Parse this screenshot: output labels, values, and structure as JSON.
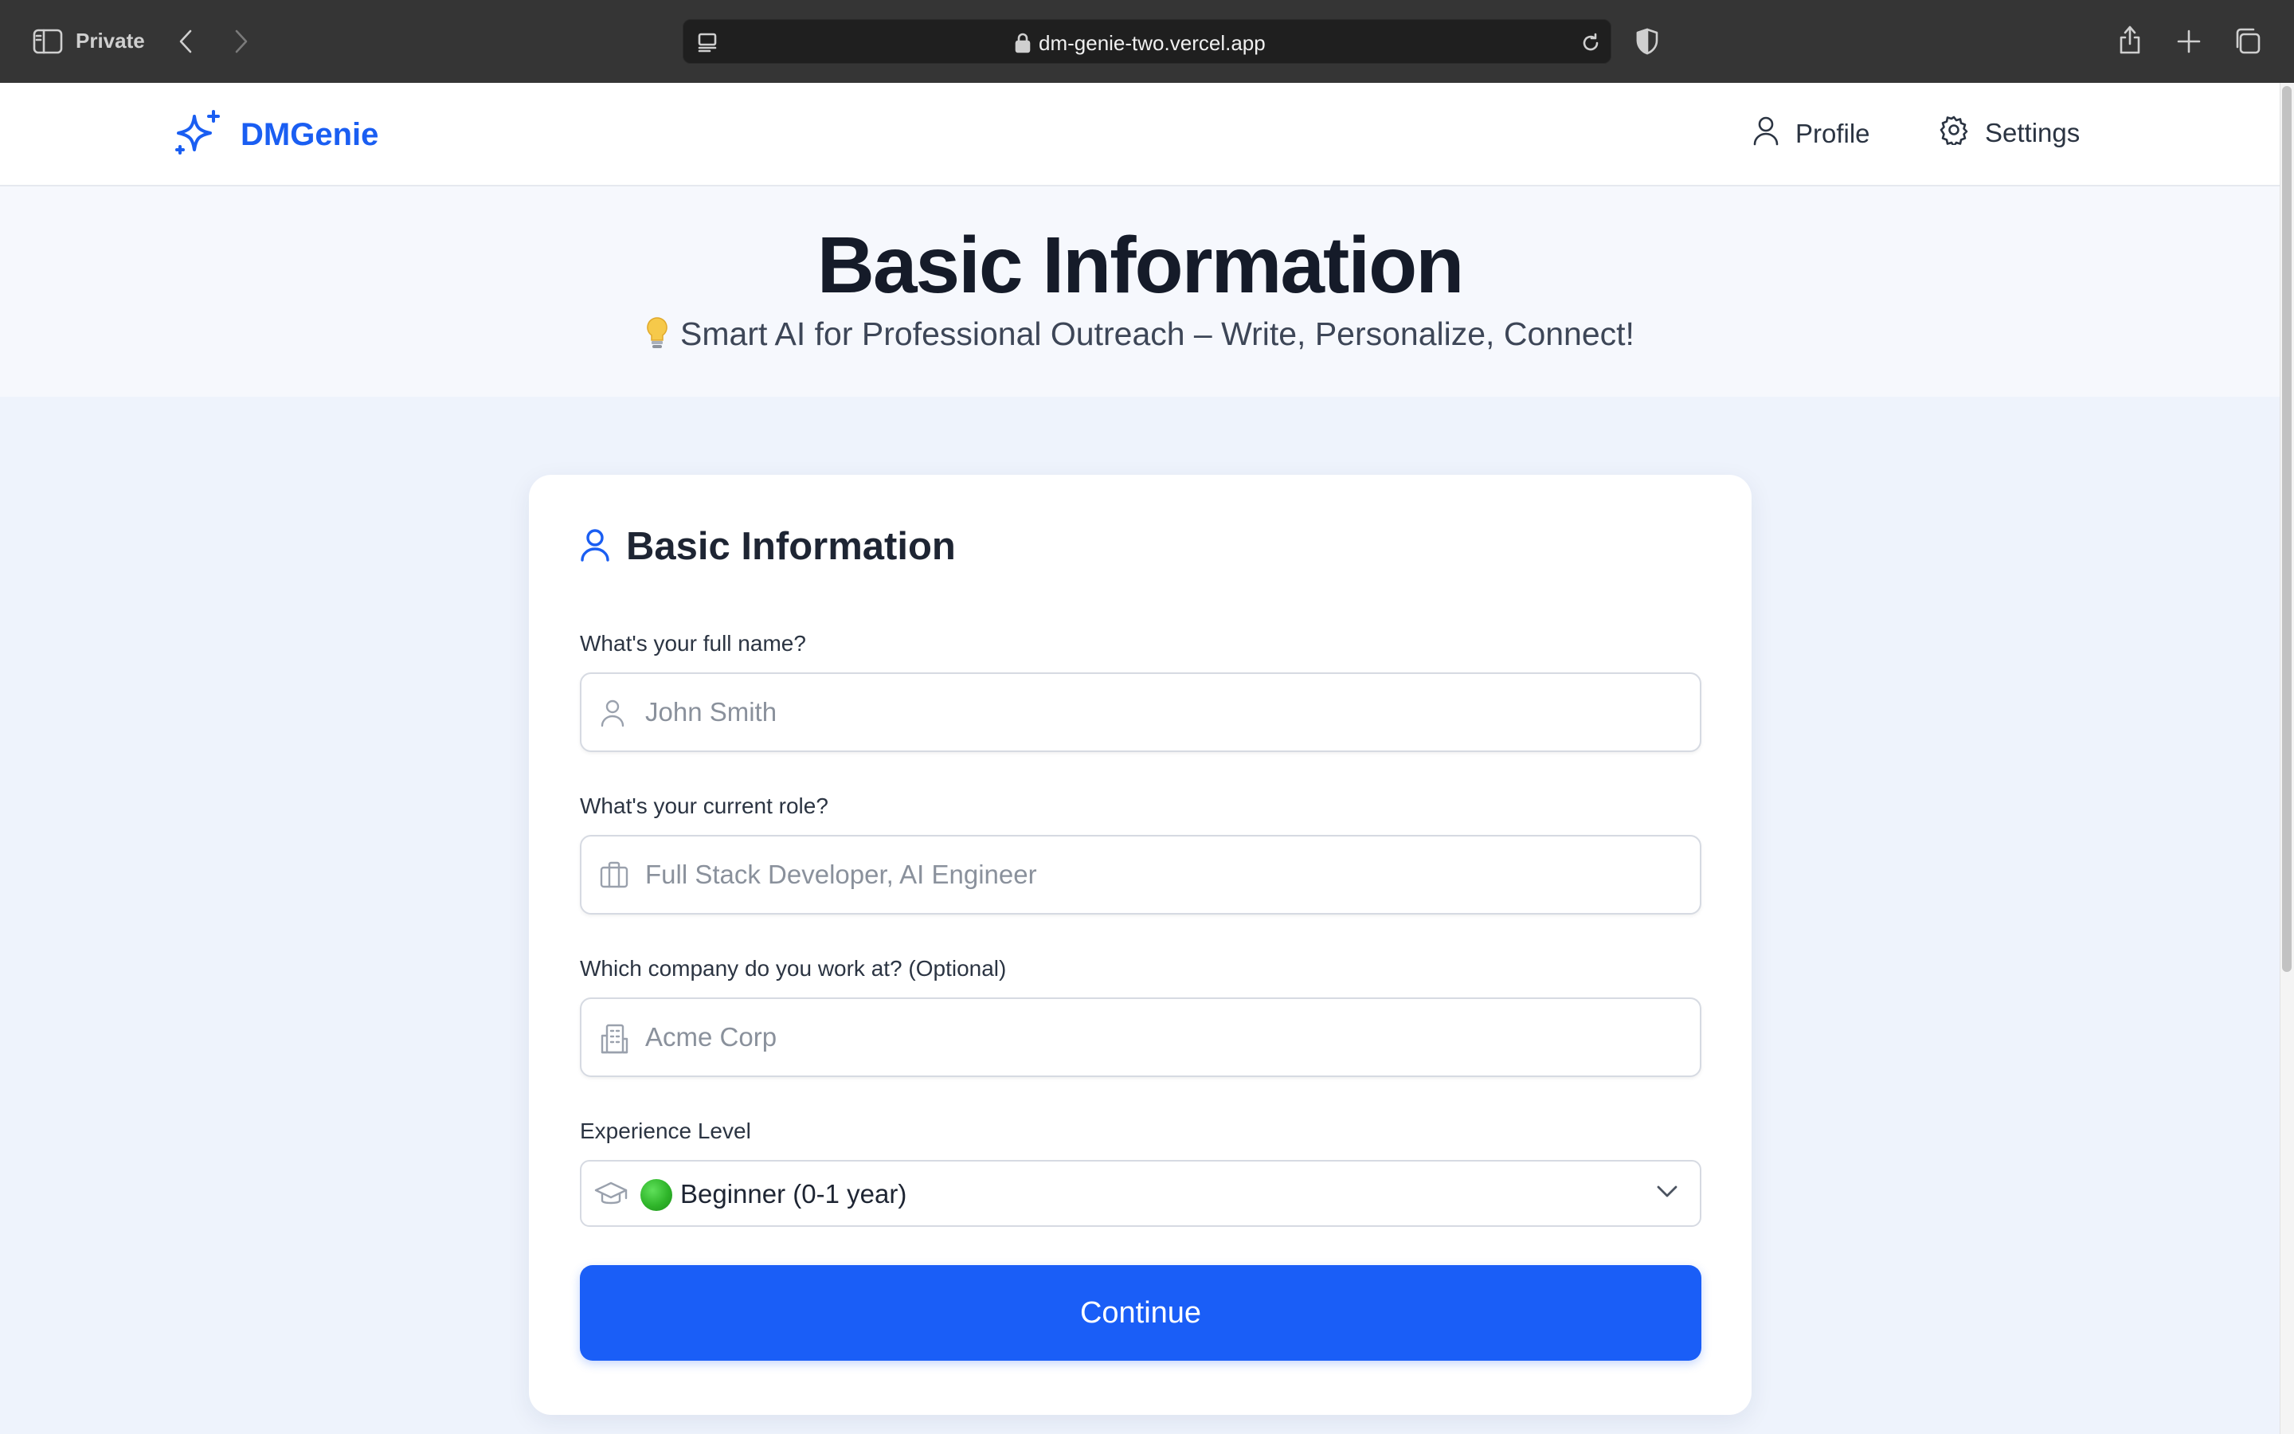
{
  "browser": {
    "private_label": "Private",
    "url": "dm-genie-two.vercel.app"
  },
  "navbar": {
    "brand": "DMGenie",
    "links": [
      {
        "label": "Profile",
        "icon": "user-icon"
      },
      {
        "label": "Settings",
        "icon": "gear-icon"
      }
    ]
  },
  "hero": {
    "title": "Basic Information",
    "subtitle": "Smart AI for Professional Outreach – Write, Personalize, Connect!"
  },
  "form": {
    "title": "Basic Information",
    "fields": [
      {
        "label": "What's your full name?",
        "placeholder": "John Smith",
        "value": "",
        "icon": "user-icon"
      },
      {
        "label": "What's your current role?",
        "placeholder": "Full Stack Developer, AI Engineer",
        "value": "",
        "icon": "briefcase-icon"
      },
      {
        "label": "Which company do you work at? (Optional)",
        "placeholder": "Acme Corp",
        "value": "",
        "icon": "building-icon"
      }
    ],
    "experience": {
      "label": "Experience Level",
      "selected": "Beginner (0-1 year)",
      "icon": "graduation-cap-icon"
    },
    "submit_label": "Continue"
  },
  "colors": {
    "accent": "#1a5ef7",
    "chrome_bg": "#353535",
    "page_bg": "#eef3fc"
  }
}
